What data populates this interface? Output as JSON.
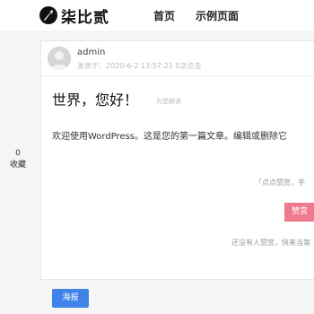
{
  "header": {
    "logo_text": "柒比贰",
    "nav": [
      {
        "label": "首页"
      },
      {
        "label": "示例页面"
      }
    ]
  },
  "sidebar": {
    "favorite_count": "0",
    "favorite_label": "收藏"
  },
  "post": {
    "author": "admin",
    "publish_info": "发表于：2020-6-2 13:57:21   0次点击",
    "title": "世界，您好！",
    "title_note": "为您解读",
    "body": "欢迎使用WordPress。这是您的第一篇文章。编辑或删除它"
  },
  "reward": {
    "hint": "「点点赞赏，手",
    "button_label": "赞赏",
    "empty_text": "还没有人赞赏，快来当第"
  },
  "footer": {
    "poster_label": "海报"
  },
  "colors": {
    "reward": "#f07a8d",
    "poster": "#3f82e8"
  }
}
